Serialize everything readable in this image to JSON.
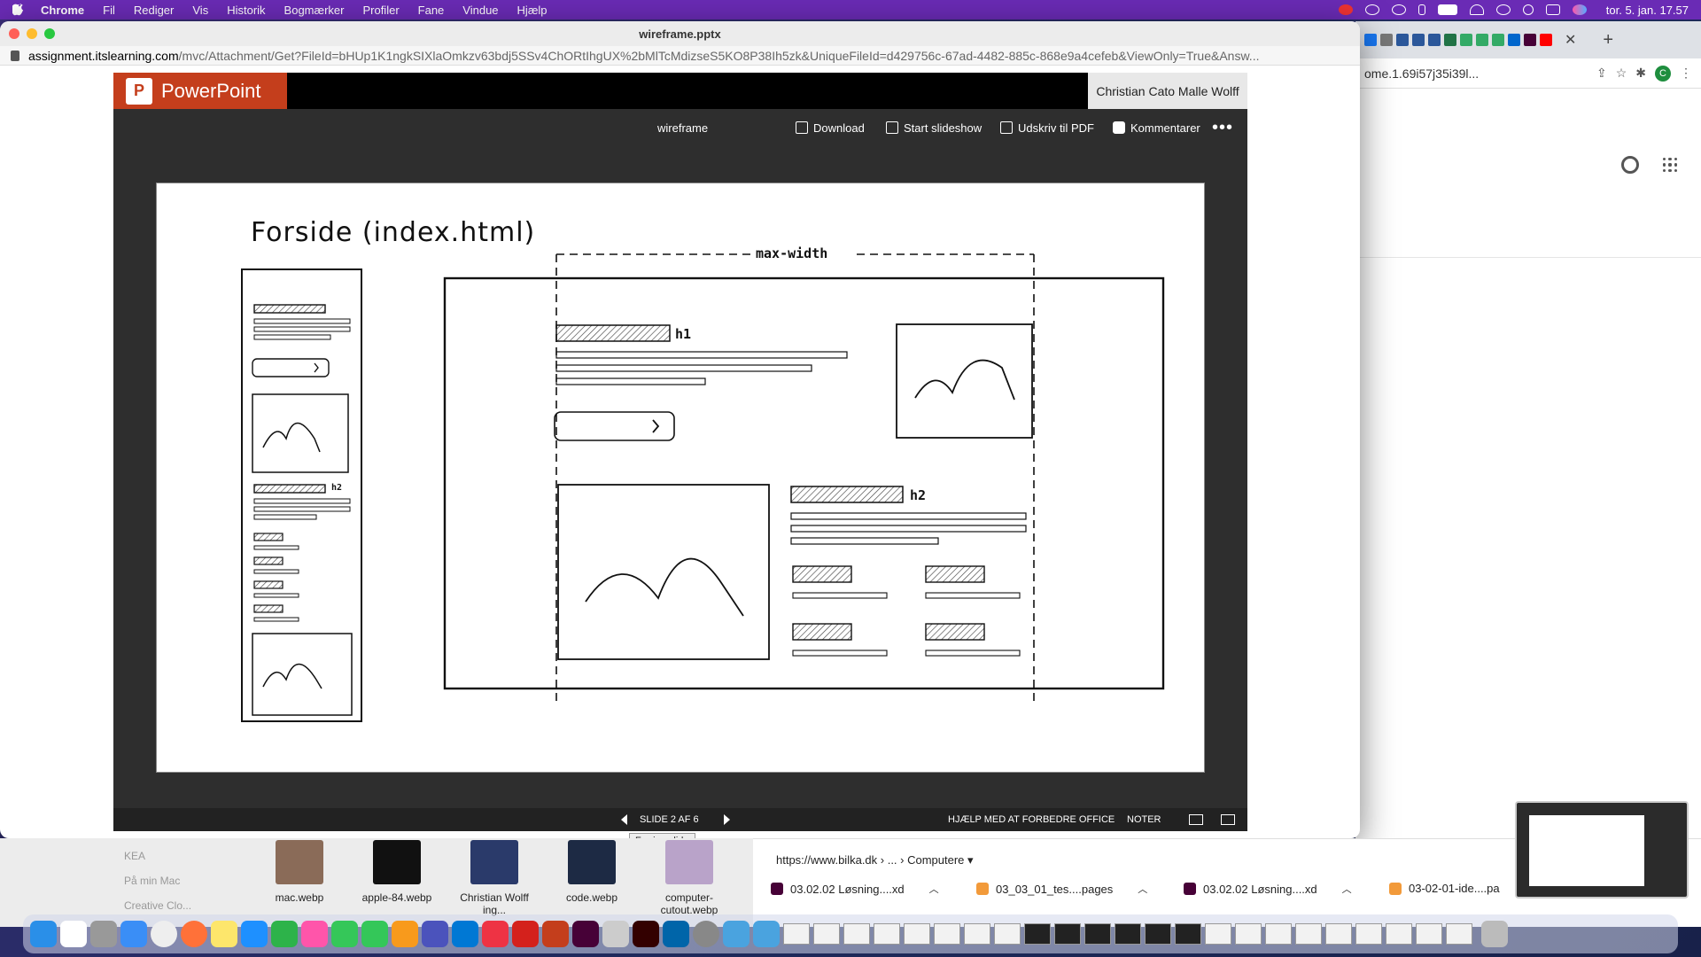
{
  "menubar": {
    "app": "Chrome",
    "items": [
      "Fil",
      "Rediger",
      "Vis",
      "Historik",
      "Bogmærker",
      "Profiler",
      "Fane",
      "Vindue",
      "Hjælp"
    ],
    "clock": "tor. 5. jan.  17.57"
  },
  "window": {
    "title": "wireframe.pptx",
    "url_domain": "assignment.itslearning.com",
    "url_rest": "/mvc/Attachment/Get?FileId=bHUp1K1ngkSIXlaOmkzv63bdj5SSv4ChORtIhgUX%2bMlTcMdizseS5KO8P38Ih5zk&UniqueFileId=d429756c-67ad-4482-885c-868e9a4cefeb&ViewOnly=True&Answ..."
  },
  "viewer": {
    "app_name": "PowerPoint",
    "user": "Christian Cato Malle Wolff",
    "file_name": "wireframe",
    "download": "Download",
    "slideshow": "Start slideshow",
    "print_pdf": "Udskriv til PDF",
    "comments": "Kommentarer",
    "more": "•••",
    "slide_counter": "SLIDE 2 AF 6",
    "help": "HJÆLP MED AT FORBEDRE OFFICE",
    "notes": "NOTER",
    "tooltip": "Forrige slide"
  },
  "slide": {
    "title": "Forside (index.html)",
    "max_width_label": "max-width",
    "h1_label": "h1",
    "h2_label": "h2",
    "mobile_h2_label": "h2"
  },
  "win2": {
    "address": "ome.1.69i57j35i39l..."
  },
  "finder": {
    "sidebar": [
      "KEA",
      "På min Mac",
      "Creative Clo..."
    ],
    "files": [
      "mac.webp",
      "apple-84.webp",
      "Christian Wolff ing...",
      "code.webp",
      "computer-cutout.webp"
    ]
  },
  "shelf": {
    "url": "https://www.bilka.dk › ... › Computere ▾",
    "downloads": [
      "03.02.02 Løsning....xd",
      "03_03_01_tes....pages",
      "03.02.02 Løsning....xd",
      "03-02-01-ide....pa"
    ]
  },
  "colors": {
    "menubar": "#6a2bb5",
    "ppt_brand": "#c43e1c",
    "viewer_bg": "#2e2e2e"
  }
}
